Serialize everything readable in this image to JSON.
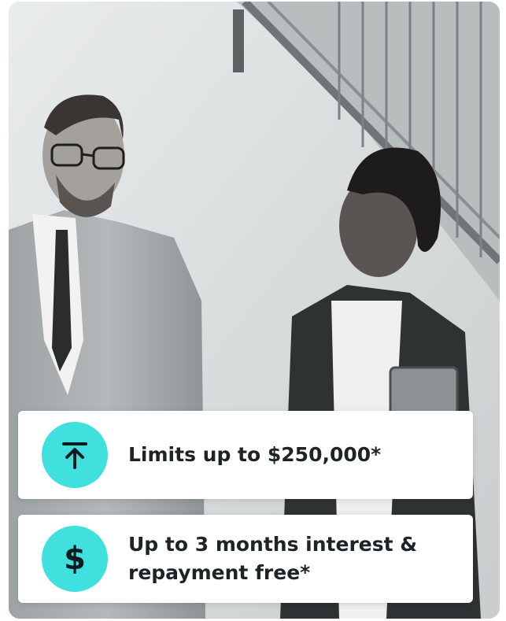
{
  "features": [
    {
      "icon": "arrow-up-to-line-icon",
      "text": "Limits up to $250,000*"
    },
    {
      "icon": "dollar-icon",
      "symbol": "$",
      "text": "Up to 3 months interest &\nrepayment free*"
    }
  ],
  "colors": {
    "accent": "#3fe0dd",
    "card_bg": "#ffffff",
    "text": "#1c2426"
  }
}
